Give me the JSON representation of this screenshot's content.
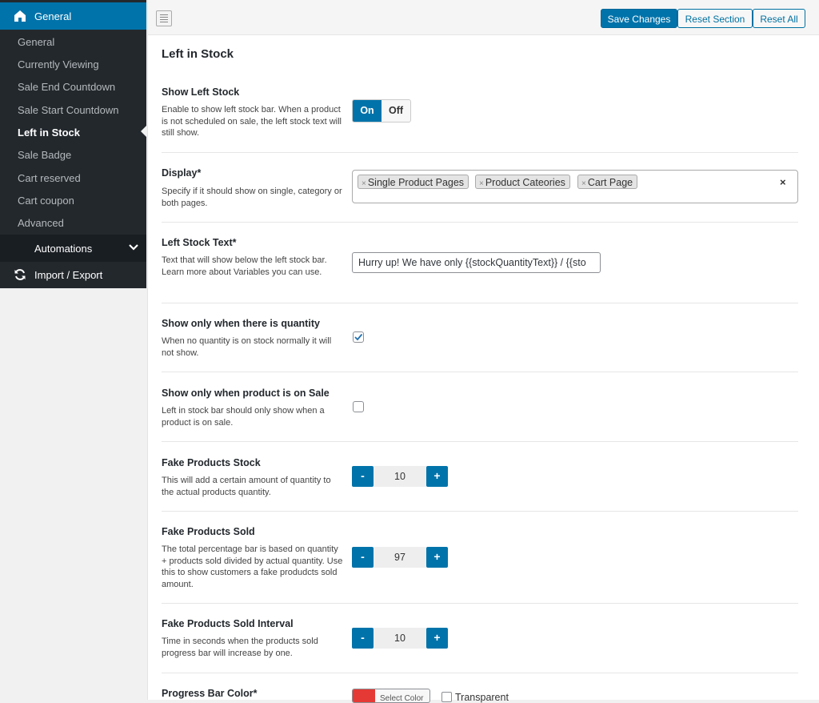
{
  "sidebar": {
    "header": {
      "label": "General",
      "icon": "home-icon"
    },
    "items": [
      {
        "label": "General"
      },
      {
        "label": "Currently Viewing"
      },
      {
        "label": "Sale End Countdown"
      },
      {
        "label": "Sale Start Countdown"
      },
      {
        "label": "Left in Stock"
      },
      {
        "label": "Sale Badge"
      },
      {
        "label": "Cart reserved"
      },
      {
        "label": "Cart coupon"
      },
      {
        "label": "Advanced"
      }
    ],
    "active_item": "Left in Stock",
    "automations": {
      "label": "Automations",
      "icon": "chevron-down-icon"
    },
    "import_export": {
      "label": "Import / Export",
      "icon": "refresh-icon"
    }
  },
  "toolbar": {
    "save_label": "Save Changes",
    "reset_section_label": "Reset Section",
    "reset_all_label": "Reset All"
  },
  "section": {
    "title": "Left in Stock"
  },
  "fields": {
    "show_left_stock": {
      "title": "Show Left Stock",
      "desc": "Enable to show left stock bar. When a product is not scheduled on sale, the left stock text will still show.",
      "on_label": "On",
      "off_label": "Off",
      "value": "On"
    },
    "display": {
      "title": "Display*",
      "desc": "Specify if it should show on single, category or both pages.",
      "chips": [
        "Single Product Pages",
        "Product Cateories",
        "Cart Page"
      ],
      "chip_remove": "×",
      "clear": "×"
    },
    "left_stock_text": {
      "title": "Left Stock Text*",
      "desc": "Text that will show below the left stock bar. Learn more about Variables you can use.",
      "value": "Hurry up! We have only {{stockQuantityText}} / {{sto"
    },
    "show_only_quantity": {
      "title": "Show only when there is quantity",
      "desc": "When no quantity is on stock normally it will not show.",
      "checked": true
    },
    "show_only_sale": {
      "title": "Show only when product is on Sale",
      "desc": "Left in stock bar should only show when a product is on sale.",
      "checked": false
    },
    "fake_stock": {
      "title": "Fake Products Stock",
      "desc": "This will add a certain amount of quantity to the actual products quantity.",
      "value": "10"
    },
    "fake_sold": {
      "title": "Fake Products Sold",
      "desc": "The total percentage bar is based on quantity + products sold divided by actual quantity. Use this to show customers a fake produdcts sold amount.",
      "value": "97"
    },
    "fake_interval": {
      "title": "Fake Products Sold Interval",
      "desc": "Time in seconds when the products sold progress bar will increase by one.",
      "value": "10"
    },
    "progress_color": {
      "title": "Progress Bar Color*",
      "select_label": "Select Color",
      "transparent_label": "Transparent",
      "color": "#e53935"
    }
  },
  "stepper": {
    "minus": "-",
    "plus": "+"
  },
  "colors": {
    "accent": "#0073aa",
    "sidebar_bg": "#23282d",
    "submenu_bg": "#191e23"
  }
}
